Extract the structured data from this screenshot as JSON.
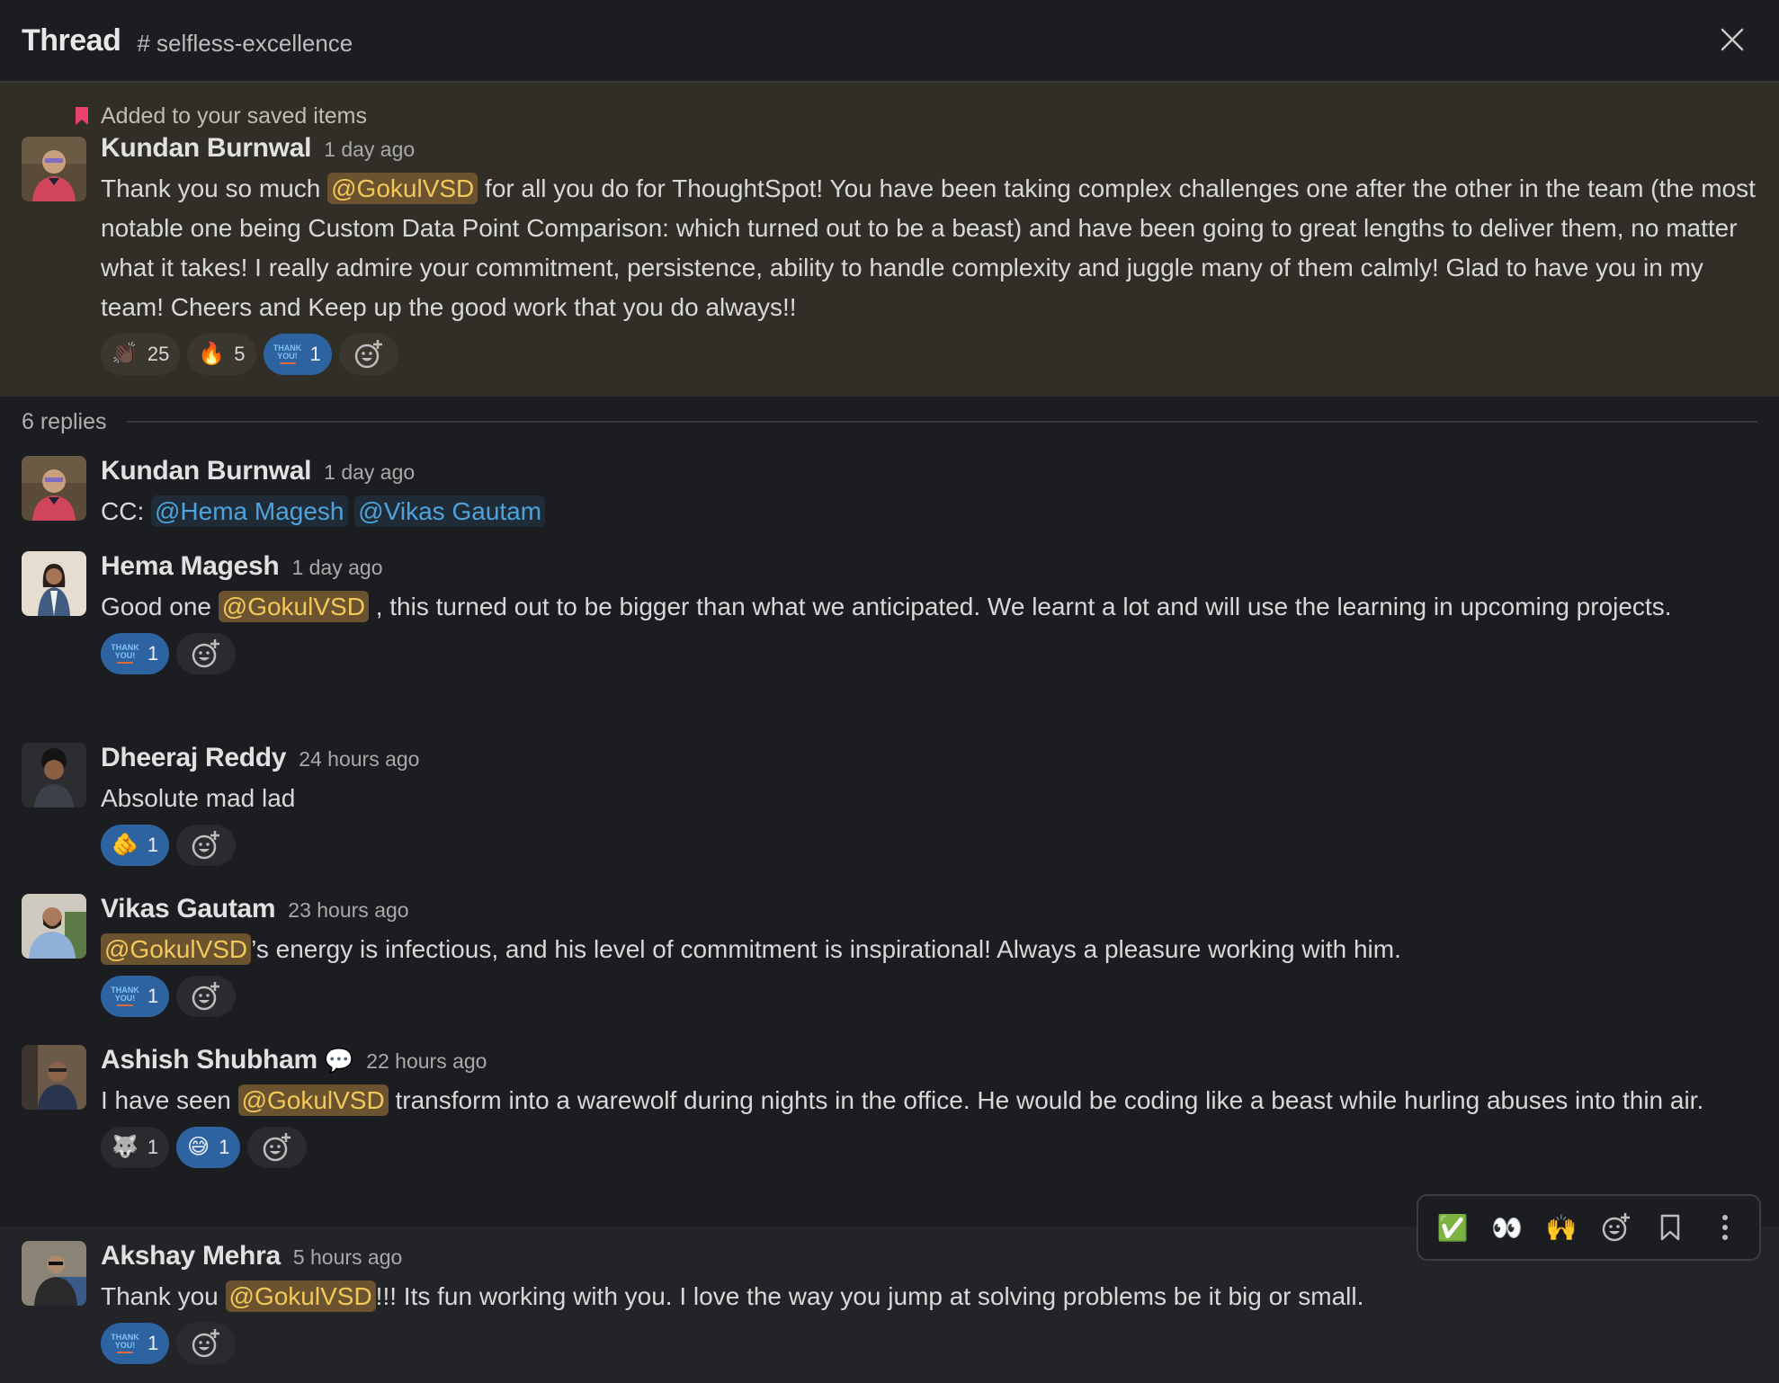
{
  "header": {
    "title": "Thread",
    "channel": "# selfless-excellence",
    "close_icon": "close-icon"
  },
  "parent": {
    "saved_label": "Added to your saved items",
    "author": "Kundan Burnwal",
    "time": "1 day ago",
    "text_before": "Thank you so much ",
    "mention": "@GokulVSD",
    "text_after": " for all you do for ThoughtSpot! You have been taking complex challenges one after the other in the team (the most notable one being Custom Data Point Comparison:  which turned out to be a beast) and have been going to great lengths to deliver them, no matter what it takes! I really admire your commitment, persistence, ability to handle complexity and juggle many of them calmly! Glad to have you in my team! Cheers and Keep up the good work that you do always!!",
    "reactions": [
      {
        "emoji": "👏🏿",
        "icon": "clapping-hands-icon",
        "count": "25",
        "active": false
      },
      {
        "emoji": "🔥",
        "icon": "fire-icon",
        "count": "5",
        "active": false
      },
      {
        "emoji": "THANK YOU!",
        "icon": "thank-you-icon",
        "count": "1",
        "active": true
      }
    ]
  },
  "replies_label": "6 replies",
  "replies": [
    {
      "author": "Kundan Burnwal",
      "time": "1 day ago",
      "prefix": "CC: ",
      "mention1": "@Hema Magesh",
      "mention2": "@Vikas Gautam"
    },
    {
      "author": "Hema Magesh",
      "time": "1 day ago",
      "text_before": "Good one ",
      "mention": "@GokulVSD",
      "text_after": " ,  this turned out to be bigger than what we anticipated. We learnt a lot and will use the learning in upcoming projects.",
      "reaction": {
        "emoji": "THANK YOU!",
        "count": "1"
      }
    },
    {
      "author": "Dheeraj Reddy",
      "time": "24 hours ago",
      "text": "Absolute mad lad",
      "reaction": {
        "emoji": "🫵",
        "count": "1"
      }
    },
    {
      "author": "Vikas Gautam",
      "time": "23 hours ago",
      "mention": "@GokulVSD",
      "text_after": "’s energy is infectious, and his level of commitment is inspirational! Always a pleasure working with him.",
      "reaction": {
        "emoji": "THANK YOU!",
        "count": "1"
      }
    },
    {
      "author": "Ashish Shubham",
      "status_emoji": "💬",
      "time": "22 hours ago",
      "text_before": "I have seen ",
      "mention": "@GokulVSD",
      "text_after": " transform into a warewolf during nights in the office. He would be coding like a beast while hurling abuses into thin air.",
      "reactions": [
        {
          "emoji": "🐺",
          "count": "1",
          "active": false
        },
        {
          "emoji": "😅",
          "count": "1",
          "active": true
        }
      ]
    },
    {
      "author": "Akshay Mehra",
      "time": "5 hours ago",
      "text_before": "Thank you ",
      "mention": "@GokulVSD",
      "text_after": "!!! Its fun working with you. I love the way you jump at solving problems be it big or small.",
      "reaction": {
        "emoji": "THANK YOU!",
        "count": "1"
      }
    }
  ],
  "toolbar": {
    "items": [
      {
        "emoji": "✅",
        "name": "check-mark-reaction"
      },
      {
        "emoji": "👀",
        "name": "eyes-reaction"
      },
      {
        "emoji": "🙌",
        "name": "raised-hands-reaction"
      }
    ]
  },
  "colors": {
    "mention_bg": "#6b532f",
    "mention_fg": "#f2c85a",
    "user_mention_fg": "#4ea3dc",
    "active_reaction": "#2e63a2",
    "saved_bookmark": "#e8416b",
    "parent_bg": "#312e28"
  }
}
